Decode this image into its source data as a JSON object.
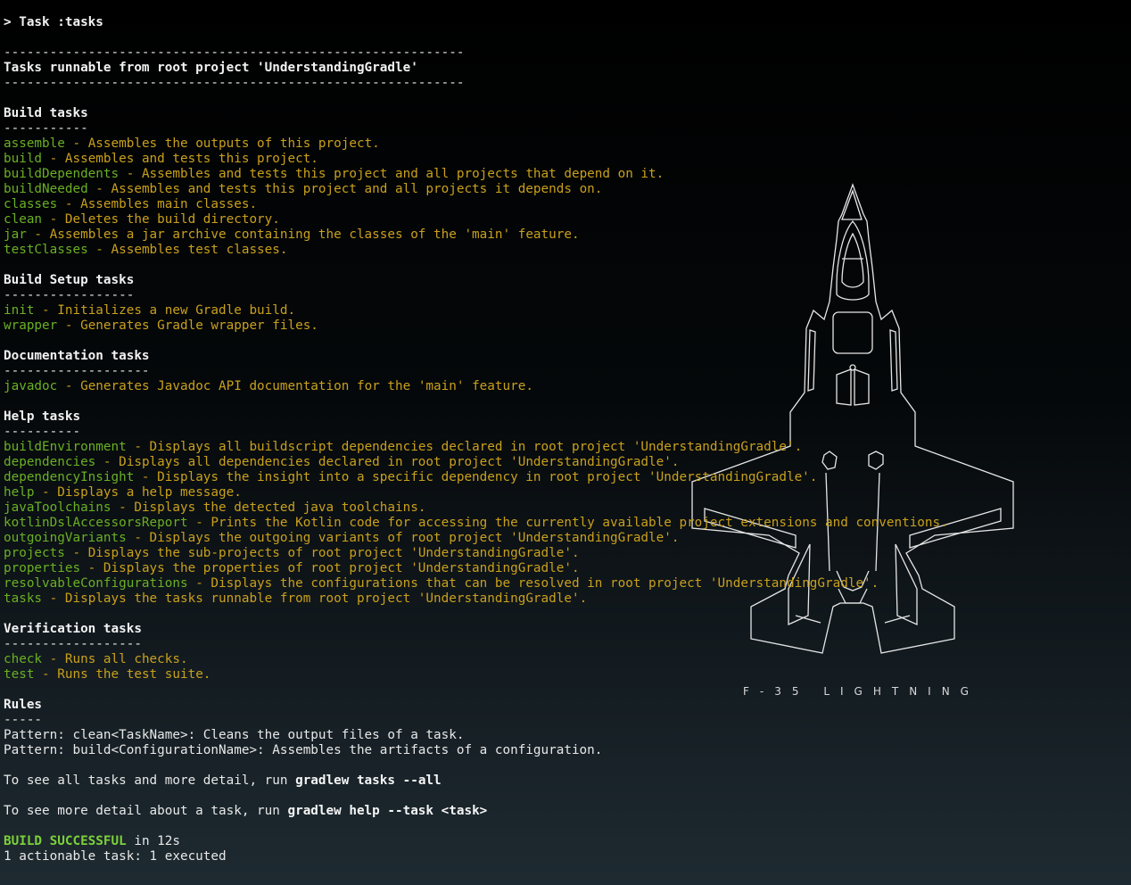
{
  "header": {
    "task_line": "> Task :tasks",
    "separator_long": "------------------------------------------------------------",
    "title": "Tasks runnable from root project 'UnderstandingGradle'"
  },
  "groups": {
    "build": {
      "title": "Build tasks",
      "underline": "-----------",
      "tasks": [
        {
          "name": "assemble",
          "desc": " - Assembles the outputs of this project."
        },
        {
          "name": "build",
          "desc": " - Assembles and tests this project."
        },
        {
          "name": "buildDependents",
          "desc": " - Assembles and tests this project and all projects that depend on it."
        },
        {
          "name": "buildNeeded",
          "desc": " - Assembles and tests this project and all projects it depends on."
        },
        {
          "name": "classes",
          "desc": " - Assembles main classes."
        },
        {
          "name": "clean",
          "desc": " - Deletes the build directory."
        },
        {
          "name": "jar",
          "desc": " - Assembles a jar archive containing the classes of the 'main' feature."
        },
        {
          "name": "testClasses",
          "desc": " - Assembles test classes."
        }
      ]
    },
    "setup": {
      "title": "Build Setup tasks",
      "underline": "-----------------",
      "tasks": [
        {
          "name": "init",
          "desc": " - Initializes a new Gradle build."
        },
        {
          "name": "wrapper",
          "desc": " - Generates Gradle wrapper files."
        }
      ]
    },
    "docs": {
      "title": "Documentation tasks",
      "underline": "-------------------",
      "tasks": [
        {
          "name": "javadoc",
          "desc": " - Generates Javadoc API documentation for the 'main' feature."
        }
      ]
    },
    "help": {
      "title": "Help tasks",
      "underline": "----------",
      "tasks": [
        {
          "name": "buildEnvironment",
          "desc": " - Displays all buildscript dependencies declared in root project 'UnderstandingGradle'."
        },
        {
          "name": "dependencies",
          "desc": " - Displays all dependencies declared in root project 'UnderstandingGradle'."
        },
        {
          "name": "dependencyInsight",
          "desc": " - Displays the insight into a specific dependency in root project 'UnderstandingGradle'."
        },
        {
          "name": "help",
          "desc": " - Displays a help message."
        },
        {
          "name": "javaToolchains",
          "desc": " - Displays the detected java toolchains."
        },
        {
          "name": "kotlinDslAccessorsReport",
          "desc": " - Prints the Kotlin code for accessing the currently available project extensions and conventions."
        },
        {
          "name": "outgoingVariants",
          "desc": " - Displays the outgoing variants of root project 'UnderstandingGradle'."
        },
        {
          "name": "projects",
          "desc": " - Displays the sub-projects of root project 'UnderstandingGradle'."
        },
        {
          "name": "properties",
          "desc": " - Displays the properties of root project 'UnderstandingGradle'."
        },
        {
          "name": "resolvableConfigurations",
          "desc": " - Displays the configurations that can be resolved in root project 'UnderstandingGradle'."
        },
        {
          "name": "tasks",
          "desc": " - Displays the tasks runnable from root project 'UnderstandingGradle'."
        }
      ]
    },
    "verification": {
      "title": "Verification tasks",
      "underline": "------------------",
      "tasks": [
        {
          "name": "check",
          "desc": " - Runs all checks."
        },
        {
          "name": "test",
          "desc": " - Runs the test suite."
        }
      ]
    }
  },
  "rules": {
    "title": "Rules",
    "underline": "-----",
    "lines": [
      "Pattern: clean<TaskName>: Cleans the output files of a task.",
      "Pattern: build<ConfigurationName>: Assembles the artifacts of a configuration."
    ]
  },
  "hints": {
    "all_prefix": "To see all tasks and more detail, run ",
    "all_cmd": "gradlew tasks --all",
    "detail_prefix": "To see more detail about a task, run ",
    "detail_cmd": "gradlew help --task <task>"
  },
  "result": {
    "status": "BUILD SUCCESSFUL",
    "time": " in 12s",
    "summary": "1 actionable task: 1 executed"
  },
  "wallpaper": {
    "caption": "F-35 LIGHTNING",
    "icon": "f35-jet-outline"
  },
  "colors": {
    "task_name": "#6ab023",
    "task_desc": "#c9a01c",
    "success": "#7cd13a",
    "text": "#e8e8e8"
  }
}
